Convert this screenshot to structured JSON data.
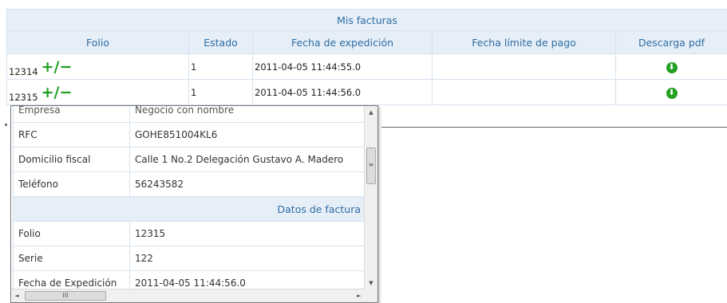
{
  "caption": "Mis facturas",
  "columns": [
    "Folio",
    "Estado",
    "Fecha de expedición",
    "Fecha límite de pago",
    "Descarga pdf"
  ],
  "rows": [
    {
      "folio": "12314",
      "toggle": "+/−",
      "estado": "1",
      "fecha": "2011-04-05 11:44:55.0",
      "limite": ""
    },
    {
      "folio": "12315",
      "toggle": "+/−",
      "estado": "1",
      "fecha": "2011-04-05 11:44:56.0",
      "limite": ""
    }
  ],
  "download_icon": "download-arrow-icon",
  "detail": {
    "cut_row": {
      "label": "Empresa",
      "value": "Negocio con nombre"
    },
    "rfc": {
      "label": "RFC",
      "value": "GOHE851004KL6"
    },
    "domicilio": {
      "label": "Domicilio fiscal",
      "value": "Calle 1 No.2 Delegación Gustavo A. Madero"
    },
    "telefono": {
      "label": "Teléfono",
      "value": "56243582"
    },
    "section": "Datos de factura",
    "folio": {
      "label": "Folio",
      "value": "12315"
    },
    "serie": {
      "label": "Serie",
      "value": "122"
    },
    "fecha": {
      "label": "Fecha de Expedición",
      "value": "2011-04-05 11:44:56.0"
    }
  },
  "scrollbar": {
    "up": "▲",
    "down": "▼",
    "left": "◄",
    "right": "►",
    "grip_v": "≡",
    "grip_h": "III"
  }
}
